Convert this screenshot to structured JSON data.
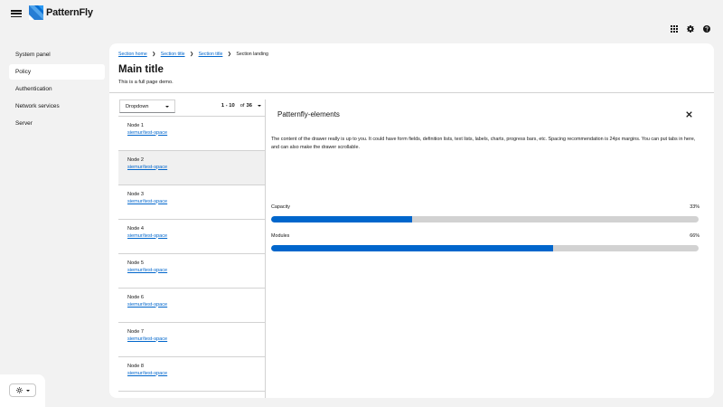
{
  "masthead": {
    "brand": "PatternFly",
    "icons": [
      "menu-icon",
      "grid-icon",
      "gear-icon",
      "help-icon"
    ]
  },
  "sidebar": {
    "items": [
      {
        "label": "System panel",
        "active": false
      },
      {
        "label": "Policy",
        "active": true
      },
      {
        "label": "Authentication",
        "active": false
      },
      {
        "label": "Network services",
        "active": false
      },
      {
        "label": "Server",
        "active": false
      }
    ],
    "theme_icon": "sun-icon"
  },
  "breadcrumb": {
    "items": [
      "Section home",
      "Section title",
      "Section title"
    ],
    "current": "Section landing"
  },
  "page": {
    "title": "Main title",
    "description": "This is a full page demo."
  },
  "toolbar": {
    "dropdown_label": "Dropdown",
    "pagination_range": "1 - 10",
    "pagination_of": "of",
    "pagination_total": "36"
  },
  "list": {
    "items": [
      {
        "title": "Node 1",
        "link": "siemur/test-space"
      },
      {
        "title": "Node 2",
        "link": "siemur/test-space"
      },
      {
        "title": "Node 3",
        "link": "siemur/test-space"
      },
      {
        "title": "Node 4",
        "link": "siemur/test-space"
      },
      {
        "title": "Node 5",
        "link": "siemur/test-space"
      },
      {
        "title": "Node 6",
        "link": "siemur/test-space"
      },
      {
        "title": "Node 7",
        "link": "siemur/test-space"
      },
      {
        "title": "Node 8",
        "link": "siemur/test-space"
      }
    ],
    "selected_index": 1
  },
  "drawer": {
    "title": "Patternfly-elements",
    "body": "The content of the drawer really is up to you. It could have form fields, definition lists, text lists, labels, charts, progress bars, etc. Spacing recommendation is 24px margins. You can put tabs in here, and can also make the drawer scrollable.",
    "progress": [
      {
        "label": "Capacity",
        "value": 33,
        "display": "33%"
      },
      {
        "label": "Modules",
        "value": 66,
        "display": "66%"
      }
    ]
  },
  "colors": {
    "accent": "#0066cc",
    "track": "#d2d2d2",
    "background": "#f2f2f2"
  }
}
